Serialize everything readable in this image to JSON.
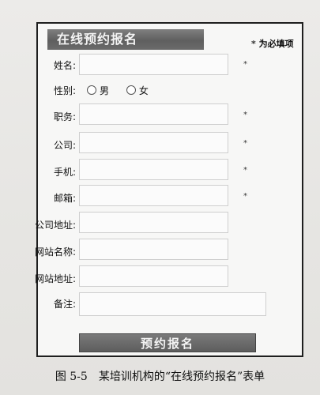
{
  "form": {
    "banner_title": "在线预约报名",
    "required_note": "为必填项",
    "required_star": "*",
    "fields": [
      {
        "label": "姓名:",
        "required": true
      },
      {
        "label": "性别:",
        "required": false
      },
      {
        "label": "职务:",
        "required": true
      },
      {
        "label": "公司:",
        "required": true
      },
      {
        "label": "手机:",
        "required": true
      },
      {
        "label": "邮箱:",
        "required": true
      },
      {
        "label": "公司地址:",
        "required": false
      },
      {
        "label": "网站名称:",
        "required": false
      },
      {
        "label": "网站地址:",
        "required": false
      },
      {
        "label": "备注:",
        "required": false
      }
    ],
    "gender_options": [
      "男",
      "女"
    ],
    "submit_label": "预约报名"
  },
  "caption": "图 5-5　某培训机构的“在线预约报名”表单"
}
